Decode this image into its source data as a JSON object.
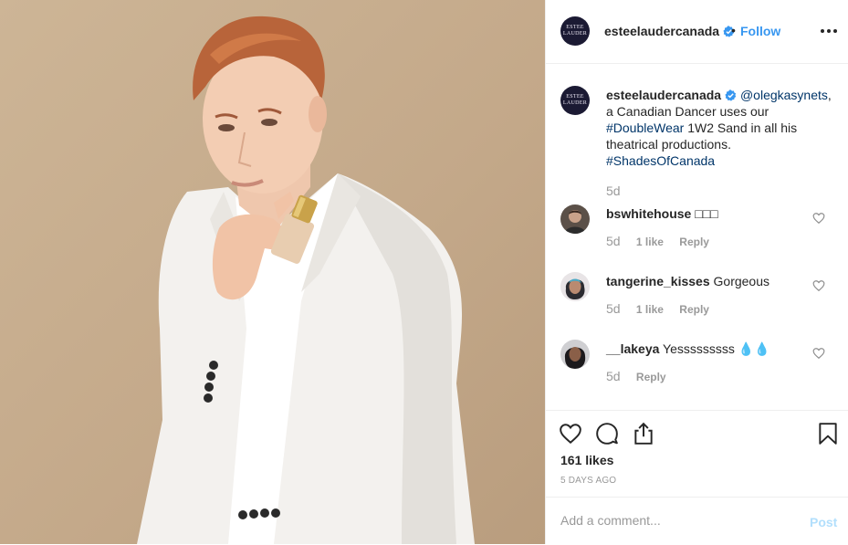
{
  "header": {
    "avatar_text": [
      "ESTEE",
      "LAUDER"
    ],
    "username": "esteelaudercanada",
    "separator": "•",
    "follow_label": "Follow",
    "more_icon": "more-dots-icon",
    "verified_icon": "verified-badge-icon"
  },
  "caption": {
    "username": "esteelaudercanada",
    "mention": "@olegkasynets",
    "text_1": ", a Canadian Dancer uses our ",
    "hashtag_1": "#DoubleWear",
    "text_2": " 1W2 Sand in all his theatrical productions. ",
    "hashtag_2": "#ShadesOfCanada",
    "time": "5d"
  },
  "comments": [
    {
      "username": "bswhitehouse",
      "text": "□□□",
      "time": "5d",
      "likes": "1 like",
      "reply": "Reply"
    },
    {
      "username": "tangerine_kisses",
      "text": "Gorgeous",
      "time": "5d",
      "likes": "1 like",
      "reply": "Reply"
    },
    {
      "username": "__lakeya",
      "text": "Yesssssssss 💧💧",
      "time": "5d",
      "likes": "",
      "reply": "Reply"
    }
  ],
  "actions": {
    "icons": [
      "heart-icon",
      "comment-icon",
      "share-icon",
      "bookmark-icon"
    ],
    "likes_count": "161 likes",
    "timestamp": "5 DAYS AGO"
  },
  "add_comment": {
    "placeholder": "Add a comment...",
    "post_label": "Post"
  },
  "colors": {
    "link": "#003569",
    "follow": "#3897f0",
    "post_disabled": "#b2dffc",
    "muted": "#999999",
    "border": "#efefef"
  }
}
